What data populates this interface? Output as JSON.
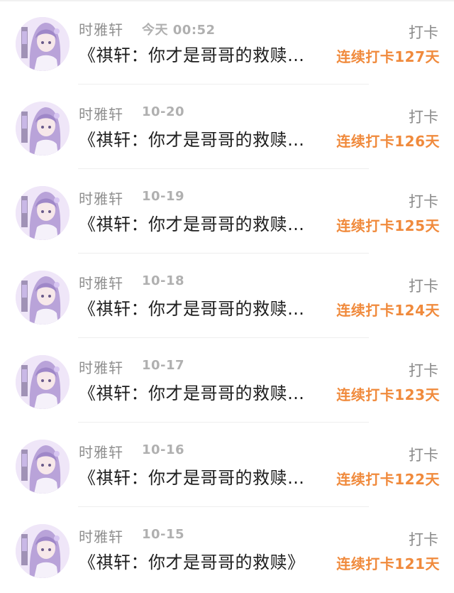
{
  "feed": {
    "items": [
      {
        "name": "时雅轩",
        "time": "今天 00:52",
        "title": "《祺轩：你才是哥哥的救赎…",
        "type": "打卡",
        "streak": "连续打卡127天"
      },
      {
        "name": "时雅轩",
        "time": "10-20",
        "title": "《祺轩：你才是哥哥的救赎…",
        "type": "打卡",
        "streak": "连续打卡126天"
      },
      {
        "name": "时雅轩",
        "time": "10-19",
        "title": "《祺轩：你才是哥哥的救赎…",
        "type": "打卡",
        "streak": "连续打卡125天"
      },
      {
        "name": "时雅轩",
        "time": "10-18",
        "title": "《祺轩：你才是哥哥的救赎…",
        "type": "打卡",
        "streak": "连续打卡124天"
      },
      {
        "name": "时雅轩",
        "time": "10-17",
        "title": "《祺轩：你才是哥哥的救赎…",
        "type": "打卡",
        "streak": "连续打卡123天"
      },
      {
        "name": "时雅轩",
        "time": "10-16",
        "title": "《祺轩：你才是哥哥的救赎…",
        "type": "打卡",
        "streak": "连续打卡122天"
      },
      {
        "name": "时雅轩",
        "time": "10-15",
        "title": "《祺轩：你才是哥哥的救赎》",
        "type": "打卡",
        "streak": "连续打卡121天"
      }
    ]
  },
  "colors": {
    "streak": "#f08a3c",
    "name": "#8f8f8f",
    "title": "#1e1e1e"
  },
  "icons": {
    "avatar": "anime-girl-avatar-icon"
  }
}
